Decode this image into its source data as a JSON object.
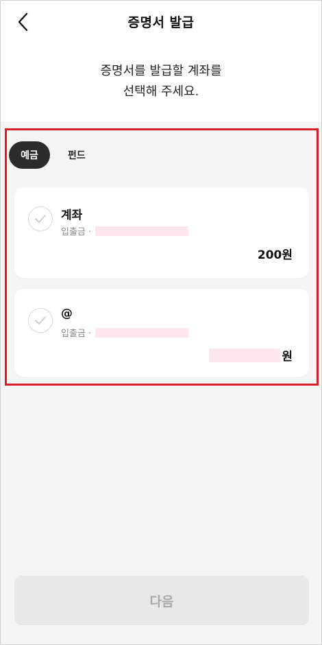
{
  "header": {
    "title": "증명서 발급",
    "back_icon": "chevron-left-icon"
  },
  "instruction": {
    "line1": "증명서를 발급할 계좌를",
    "line2": "선택해 주세요."
  },
  "tabs": [
    {
      "label": "예금",
      "selected": true
    },
    {
      "label": "펀드",
      "selected": false
    }
  ],
  "accounts": [
    {
      "name": "계좌",
      "type_label": "입출금 ·",
      "amount": "200원"
    },
    {
      "name": "@",
      "type_label": "입출금 ·",
      "amount_unit": "원"
    }
  ],
  "next_button": {
    "label": "다음",
    "enabled": false
  },
  "colors": {
    "highlight": "#d61f26",
    "tab_active": "#2b2b2b",
    "background_gray": "#f5f5f5",
    "redaction": "#fde6ee",
    "button_disabled": "#e8e8e8"
  }
}
